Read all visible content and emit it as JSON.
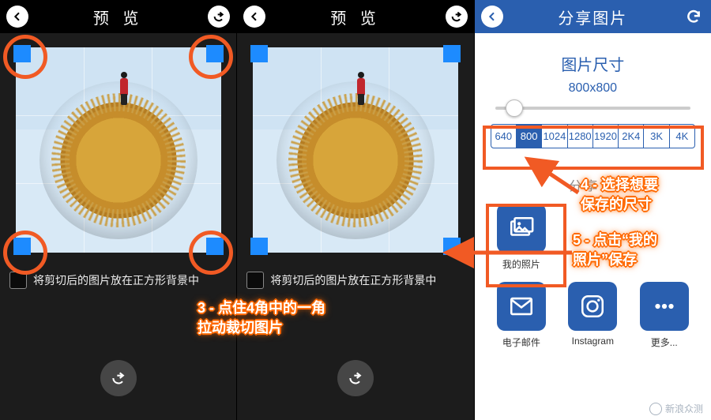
{
  "panel1": {
    "title": "预 览",
    "checkbox_label": "将剪切后的图片放在正方形背景中"
  },
  "panel2": {
    "title": "预 览",
    "checkbox_label": "将剪切后的图片放在正方形背景中"
  },
  "panel3": {
    "title": "分享图片",
    "size_heading": "图片尺寸",
    "size_value": "800x800",
    "sizes": [
      "640",
      "800",
      "1024",
      "1280",
      "1920",
      "2K4",
      "3K",
      "4K"
    ],
    "active_size_index": 1,
    "share_to_label": "分享到",
    "share_items": [
      {
        "id": "my-photos",
        "label": "我的照片"
      },
      {
        "id": "email",
        "label": "电子邮件"
      },
      {
        "id": "instagram",
        "label": "Instagram"
      },
      {
        "id": "more",
        "label": "更多..."
      }
    ]
  },
  "callouts": {
    "c3_line1": "3 - 点住4角中的一角",
    "c3_line2": "拉动裁切图片",
    "c4_line1": "4 - 选择想要",
    "c4_line2": "保存的尺寸",
    "c5_line1": "5 - 点击“我的",
    "c5_line2": "照片”保存"
  },
  "colors": {
    "accent_orange": "#f15a24",
    "brand_blue": "#2a5faf",
    "handle_blue": "#1d8bff"
  },
  "slider_position_pct": 10,
  "watermark": "新浪众测"
}
